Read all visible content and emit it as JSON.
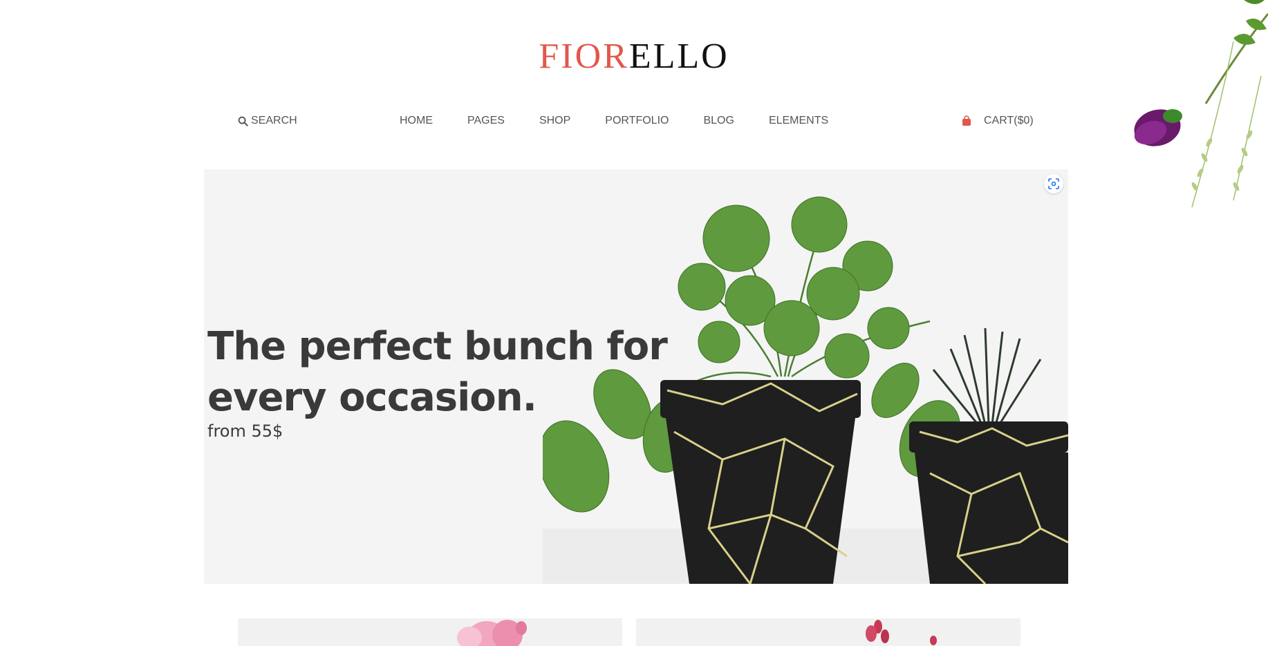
{
  "brand": {
    "logo_accent": "FIOR",
    "logo_rest": "ELLO",
    "accent_color": "#e2574c"
  },
  "header": {
    "search_label": "SEARCH",
    "menu": [
      {
        "label": "HOME"
      },
      {
        "label": "PAGES"
      },
      {
        "label": "SHOP"
      },
      {
        "label": "PORTFOLIO"
      },
      {
        "label": "BLOG"
      },
      {
        "label": "ELEMENTS"
      }
    ],
    "cart_label": "CART($0)"
  },
  "hero": {
    "title_line1": "The perfect bunch for",
    "title_line2": "every occasion.",
    "subtitle": "from 55$"
  },
  "icons": [
    "search-icon",
    "shopping-bag-icon",
    "visual-search-icon",
    "flower-decoration",
    "plant-pots-image"
  ]
}
